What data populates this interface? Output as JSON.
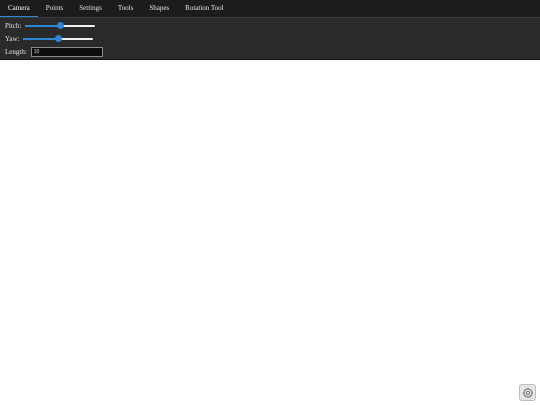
{
  "tabs": [
    {
      "label": "Camera",
      "active": true
    },
    {
      "label": "Points",
      "active": false
    },
    {
      "label": "Settings",
      "active": false
    },
    {
      "label": "Tools",
      "active": false
    },
    {
      "label": "Shapes",
      "active": false
    },
    {
      "label": "Rotation Tool",
      "active": false
    }
  ],
  "camera": {
    "pitch": {
      "label": "Pitch:",
      "value_fraction": 0.5
    },
    "yaw": {
      "label": "Yaw:",
      "value_fraction": 0.5
    },
    "length": {
      "label": "Length:",
      "value": "10"
    }
  },
  "icons": {
    "settings": "gear-icon"
  },
  "colors": {
    "accent": "#2f86d6",
    "tabbar_bg": "#1c1c1c",
    "panel_bg": "#2a2a2a",
    "viewport_bg": "#ffffff"
  }
}
